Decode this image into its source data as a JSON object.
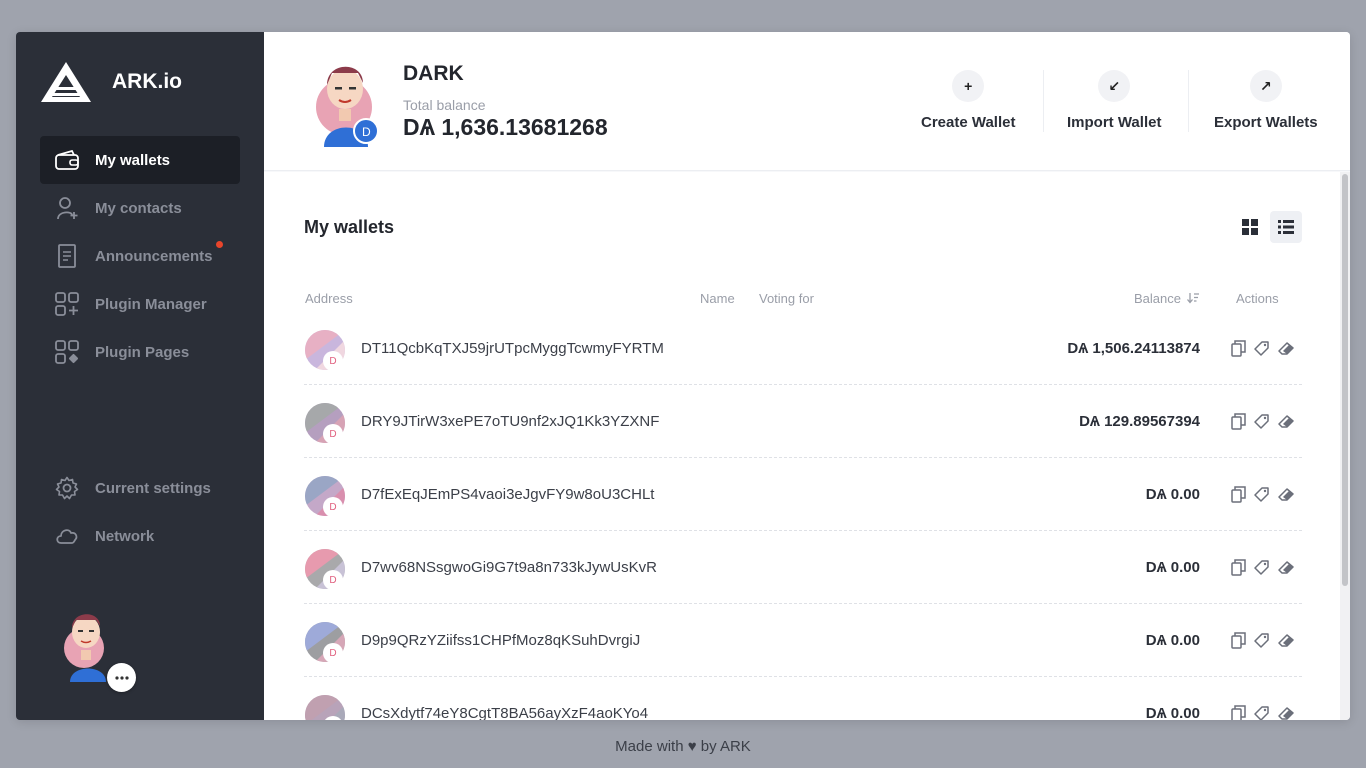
{
  "brand": {
    "name": "ARK.io"
  },
  "sidebar": {
    "items": [
      {
        "label": "My wallets"
      },
      {
        "label": "My contacts"
      },
      {
        "label": "Announcements"
      },
      {
        "label": "Plugin Manager"
      },
      {
        "label": "Plugin Pages"
      }
    ],
    "bottom_items": [
      {
        "label": "Current settings"
      },
      {
        "label": "Network"
      }
    ]
  },
  "header": {
    "wallet_name": "DARK",
    "total_balance_label": "Total balance",
    "total_balance_value": "DѦ 1,636.13681268",
    "actions": [
      {
        "label": "Create Wallet",
        "icon": "+"
      },
      {
        "label": "Import Wallet",
        "icon": "↙"
      },
      {
        "label": "Export Wallets",
        "icon": "↗"
      }
    ]
  },
  "wallets": {
    "title": "My wallets",
    "columns": {
      "address": "Address",
      "name": "Name",
      "voting_for": "Voting for",
      "balance": "Balance",
      "actions": "Actions"
    },
    "rows": [
      {
        "address": "DT11QcbKqTXJ59jrUTpcMyggTcwmyFYRTM",
        "balance": "DѦ 1,506.24113874",
        "badge": "D"
      },
      {
        "address": "DRY9JTirW3xePE7oTU9nf2xJQ1Kk3YZXNF",
        "balance": "DѦ 129.89567394",
        "badge": "D"
      },
      {
        "address": "D7fExEqJEmPS4vaoi3eJgvFY9w8oU3CHLt",
        "balance": "DѦ 0.00",
        "badge": "D"
      },
      {
        "address": "D7wv68NSsgwoGi9G7t9a8n733kJywUsKvR",
        "balance": "DѦ 0.00",
        "badge": "D"
      },
      {
        "address": "D9p9QRzYZiifss1CHPfMoz8qKSuhDvrgiJ",
        "balance": "DѦ 0.00",
        "badge": "D"
      },
      {
        "address": "DCsXdytf74eY8CgtT8BA56ayXzF4aoKYo4",
        "balance": "DѦ 0.00",
        "badge": "D"
      }
    ]
  },
  "footer": {
    "text": "Made with ♥ by ARK"
  },
  "colors": {
    "sidebar_bg": "#2b2f38",
    "sidebar_active_bg": "#1c1f26",
    "page_bg": "#9fa3ad",
    "notification_dot": "#e8452b",
    "accent_pink": "#e0607f"
  },
  "icons": {
    "sidebar": [
      "wallet-icon",
      "contacts-icon",
      "announcements-icon",
      "plugin-manager-icon",
      "plugin-pages-icon",
      "settings-icon",
      "cloud-icon"
    ],
    "view_toggle": [
      "grid-view-icon",
      "list-view-icon"
    ],
    "row_actions": [
      "copy-icon",
      "tag-icon",
      "eraser-icon"
    ]
  }
}
